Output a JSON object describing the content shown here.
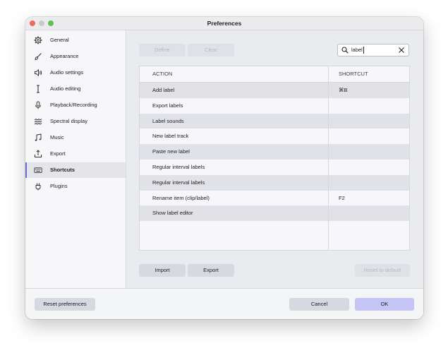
{
  "window": {
    "title": "Preferences"
  },
  "sidebar": {
    "items": [
      {
        "label": "General",
        "icon": "gear-icon",
        "active": false
      },
      {
        "label": "Appearance",
        "icon": "brush-icon",
        "active": false
      },
      {
        "label": "Audio settings",
        "icon": "speaker-icon",
        "active": false
      },
      {
        "label": "Audio editing",
        "icon": "text-cursor-icon",
        "active": false
      },
      {
        "label": "Playback/Recording",
        "icon": "microphone-icon",
        "active": false
      },
      {
        "label": "Spectral display",
        "icon": "spectral-icon",
        "active": false
      },
      {
        "label": "Music",
        "icon": "music-note-icon",
        "active": false
      },
      {
        "label": "Export",
        "icon": "export-icon",
        "active": false
      },
      {
        "label": "Shortcuts",
        "icon": "keyboard-icon",
        "active": true
      },
      {
        "label": "Plugins",
        "icon": "plugin-icon",
        "active": false
      }
    ]
  },
  "toolbar": {
    "define_label": "Define",
    "clear_label": "Clear"
  },
  "search": {
    "value": "label",
    "icon": "search-icon",
    "clear_icon": "close-icon"
  },
  "table": {
    "headers": {
      "action": "ACTION",
      "shortcut": "SHORTCUT"
    },
    "rows": [
      {
        "action": "Add label",
        "shortcut": "⌘B"
      },
      {
        "action": "Export labels",
        "shortcut": ""
      },
      {
        "action": "Label sounds",
        "shortcut": ""
      },
      {
        "action": "New label track",
        "shortcut": ""
      },
      {
        "action": "Paste new label",
        "shortcut": ""
      },
      {
        "action": "Regular interval labels",
        "shortcut": ""
      },
      {
        "action": "Regular interval labels",
        "shortcut": ""
      },
      {
        "action": "Rename item (clip/label)",
        "shortcut": "F2"
      },
      {
        "action": "Show label editor",
        "shortcut": ""
      }
    ]
  },
  "actions": {
    "import_label": "Import",
    "export_label": "Export",
    "reset_default_label": "Reset to default"
  },
  "footer": {
    "reset_prefs_label": "Reset preferences",
    "cancel_label": "Cancel",
    "ok_label": "OK"
  },
  "colors": {
    "accent": "#6a6fd6",
    "ok_button": "#c4c5f5",
    "selected_row": "#e1e2e7"
  }
}
